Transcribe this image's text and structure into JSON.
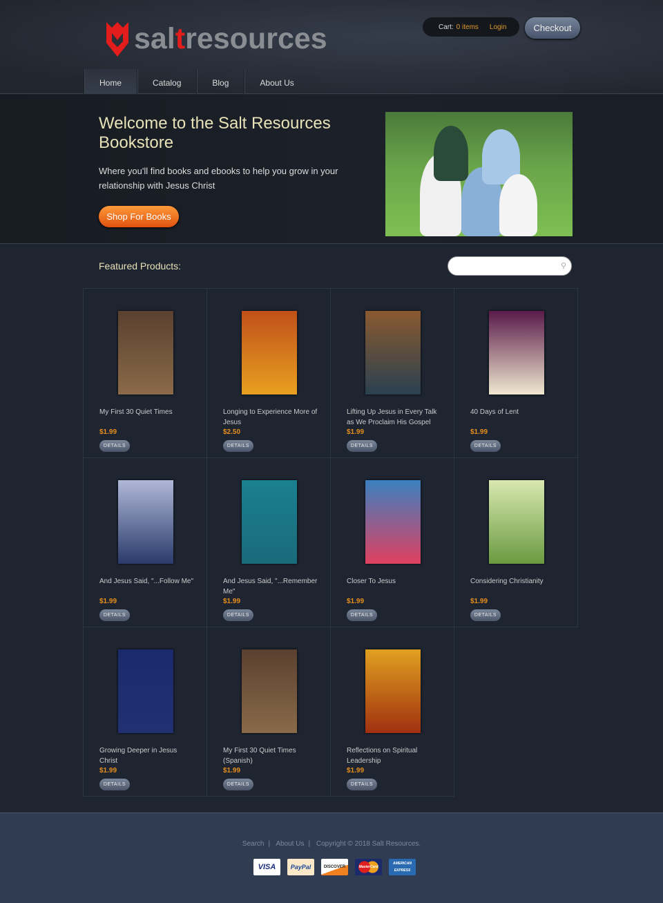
{
  "header": {
    "logo_text_pre": "sal",
    "logo_text_t": "t",
    "logo_text_post": "resources",
    "cart_label": "Cart:",
    "cart_items": "0 items",
    "login": "Login",
    "checkout": "Checkout"
  },
  "nav": [
    "Home",
    "Catalog",
    "Blog",
    "About Us"
  ],
  "hero": {
    "title": "Welcome to the Salt Resources Bookstore",
    "text": "Where you'll find books and ebooks to help you grow in your relationship with Jesus Christ",
    "button": "Shop For Books"
  },
  "featured": {
    "heading": "Featured Products:",
    "search_placeholder": "",
    "search_icon": "magnifier-icon"
  },
  "products": [
    {
      "title": "My First 30 Quiet Times",
      "price": "$1.99",
      "details": "DETAILS",
      "cover": [
        "#5a4030",
        "#8a6a48"
      ]
    },
    {
      "title": "Longing to Experience More of Jesus",
      "price": "$2.50",
      "details": "DETAILS",
      "cover": [
        "#c0501a",
        "#e8a020"
      ]
    },
    {
      "title": "Lifting Up Jesus in Every Talk as We Proclaim His Gospel",
      "price": "$1.99",
      "details": "DETAILS",
      "cover": [
        "#8a5a30",
        "#2a4050"
      ]
    },
    {
      "title": "40 Days of Lent",
      "price": "$1.99",
      "details": "DETAILS",
      "cover": [
        "#5a1a4a",
        "#f0e8d0"
      ]
    },
    {
      "title": "And Jesus Said, \"...Follow Me\"",
      "price": "$1.99",
      "details": "DETAILS",
      "cover": [
        "#b0b8d8",
        "#2a3a6a"
      ]
    },
    {
      "title": "And Jesus Said, \"...Remember Me\"",
      "price": "$1.99",
      "details": "DETAILS",
      "cover": [
        "#1a8090",
        "#1a6a7a"
      ]
    },
    {
      "title": "Closer To Jesus",
      "price": "$1.99",
      "details": "DETAILS",
      "cover": [
        "#3a80c0",
        "#e04060"
      ]
    },
    {
      "title": "Considering Christianity",
      "price": "$1.99",
      "details": "DETAILS",
      "cover": [
        "#d8e8b0",
        "#6a9a40"
      ]
    },
    {
      "title": "Growing Deeper in Jesus Christ",
      "price": "$1.99",
      "details": "DETAILS",
      "cover": [
        "#1a2a6a",
        "#203070"
      ]
    },
    {
      "title": "My First 30 Quiet Times (Spanish)",
      "price": "$1.99",
      "details": "DETAILS",
      "cover": [
        "#5a4030",
        "#8a6a48"
      ]
    },
    {
      "title": "Reflections on Spiritual Leadership",
      "price": "$1.99",
      "details": "DETAILS",
      "cover": [
        "#e0a020",
        "#a03010"
      ]
    }
  ],
  "footer": {
    "links": [
      "Search",
      "About Us"
    ],
    "copyright": "Copyright © 2018 Salt Resources.",
    "cards": [
      "VISA",
      "PayPal",
      "DISCOVER",
      "MasterCard",
      "AMERICAN EXPRESS"
    ]
  },
  "colors": {
    "accent": "#e8901c",
    "logo_red": "#e31c1c",
    "heading": "#e8e2b8"
  }
}
